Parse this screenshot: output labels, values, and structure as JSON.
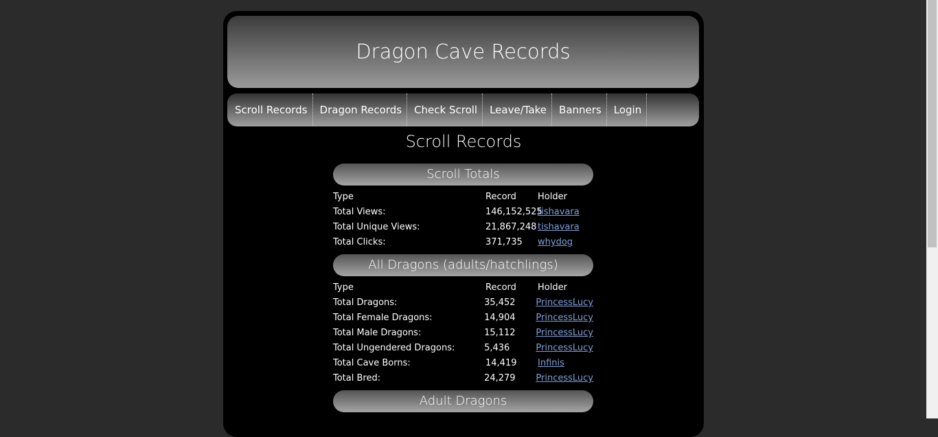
{
  "header": {
    "title": "Dragon Cave Records"
  },
  "nav": [
    "Scroll Records",
    "Dragon Records",
    "Check Scroll",
    "Leave/Take",
    "Banners",
    "Login"
  ],
  "page_title": "Scroll Records",
  "columns": {
    "type": "Type",
    "record": "Record",
    "holder": "Holder"
  },
  "sections": [
    {
      "title": "Scroll Totals",
      "rows": [
        {
          "type": "Total Views:",
          "record": "146,152,525",
          "holder": "tishavara"
        },
        {
          "type": "Total Unique Views:",
          "record": "21,867,248",
          "holder": "tishavara"
        },
        {
          "type": "Total Clicks:",
          "record": "371,735",
          "holder": "whydog"
        }
      ]
    },
    {
      "title": "All Dragons (adults/hatchlings)",
      "rows": [
        {
          "type": "Total Dragons:",
          "record": "35,452",
          "holder": "PrincessLucy"
        },
        {
          "type": "Total Female Dragons:",
          "record": "14,904",
          "holder": "PrincessLucy"
        },
        {
          "type": "Total Male Dragons:",
          "record": "15,112",
          "holder": "PrincessLucy"
        },
        {
          "type": "Total Ungendered Dragons:",
          "record": "5,436",
          "holder": "PrincessLucy"
        },
        {
          "type": "Total Cave Borns:",
          "record": "14,419",
          "holder": "Infinis"
        },
        {
          "type": "Total Bred:",
          "record": "24,279",
          "holder": "PrincessLucy"
        }
      ]
    },
    {
      "title": "Adult Dragons",
      "rows": []
    }
  ]
}
